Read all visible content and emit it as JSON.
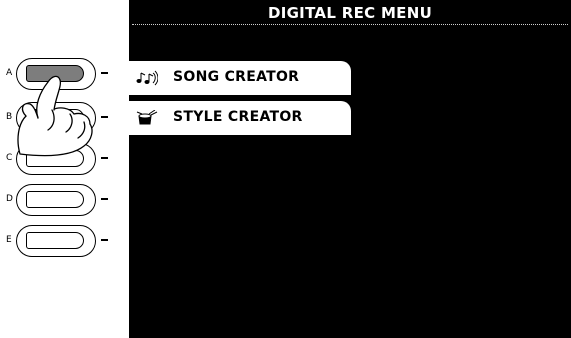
{
  "panel_buttons": [
    {
      "letter": "A",
      "pressed": true
    },
    {
      "letter": "B",
      "pressed": false
    },
    {
      "letter": "C",
      "pressed": false
    },
    {
      "letter": "D",
      "pressed": false
    },
    {
      "letter": "E",
      "pressed": false
    }
  ],
  "screen": {
    "title": "DIGITAL REC MENU",
    "menu": [
      {
        "label": "SONG CREATOR",
        "icon": "song-notes-icon"
      },
      {
        "label": "STYLE CREATOR",
        "icon": "style-drum-icon"
      }
    ]
  }
}
